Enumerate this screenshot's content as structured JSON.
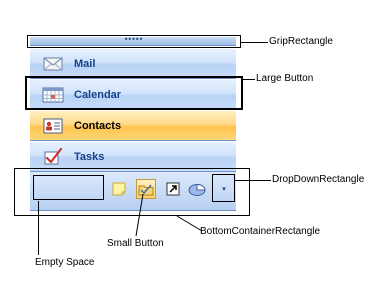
{
  "navigation_pane": {
    "grip_dots": "•••••",
    "buttons": [
      {
        "label": "Mail",
        "icon": "envelope-icon",
        "selected": false
      },
      {
        "label": "Calendar",
        "icon": "calendar-icon",
        "selected": false
      },
      {
        "label": "Contacts",
        "icon": "contacts-card-icon",
        "selected": true
      },
      {
        "label": "Tasks",
        "icon": "task-checkbox-icon",
        "selected": false
      }
    ],
    "bottom_container": {
      "small_buttons": [
        "notes-icon",
        "folder-list-icon",
        "shortcut-icon",
        "journal-icon"
      ],
      "dropdown_glyph": "▾"
    }
  },
  "annotations": {
    "grip_rectangle": "GripRectangle",
    "large_button": "Large Button",
    "dropdown_rectangle": "DropDownRectangle",
    "bottom_container_rectangle": "BottomContainerRectangle",
    "small_button": "Small Button",
    "empty_space": "Empty Space"
  },
  "colors": {
    "button_blue_top": "#e6f0fd",
    "button_blue_bottom": "#b9d2f5",
    "selected_orange_top": "#fff0c0",
    "selected_orange_bottom": "#ffc44d",
    "label_blue": "#15428b",
    "border_blue": "#6f93c9"
  }
}
